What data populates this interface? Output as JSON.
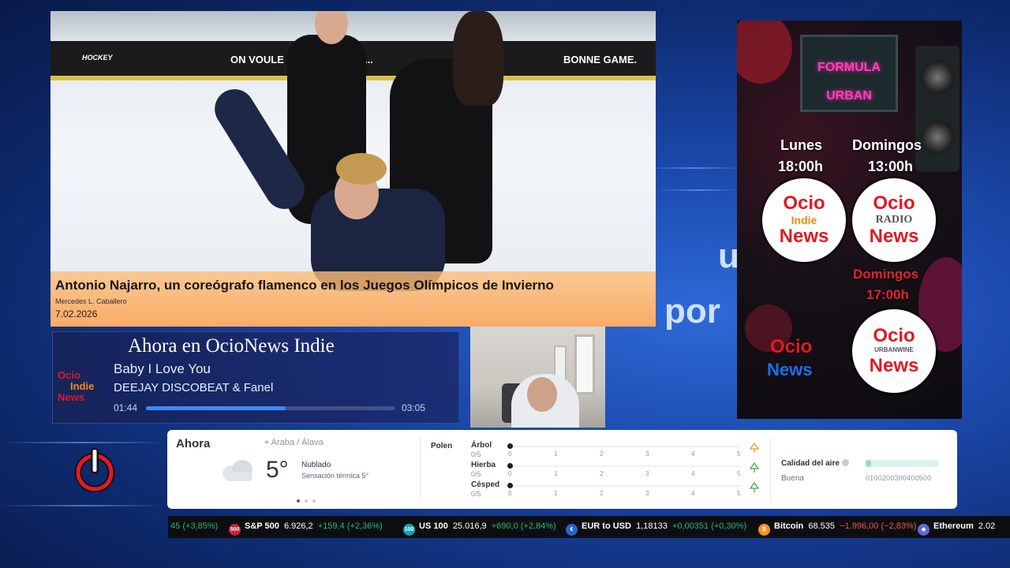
{
  "background": {
    "text_fragment_1": "u",
    "text_fragment_2": "por"
  },
  "news": {
    "title": "Antonio Najarro, un coreógrafo flamenco en los Juegos Olímpicos de Invierno",
    "author": "Mercedes L. Caballero",
    "date": "7.02.2026",
    "board_text_left": "ON VOULE",
    "board_text_mid": "RE...",
    "board_text_right": "BONNE GAME.",
    "board_brand": "HOCKEY"
  },
  "now_playing": {
    "header": "Ahora en OcioNews Indie",
    "song": "Baby I Love You",
    "artist": "DEEJAY DISCOBEAT & Fanel",
    "elapsed": "01:44",
    "duration": "03:05",
    "progress": 0.56,
    "logo": {
      "line1": "Ocio",
      "line2": "Indie",
      "line3": "News"
    }
  },
  "poster": {
    "tv_line1": "FORMULA",
    "tv_line2": "URBAN",
    "day_left": "Lunes",
    "hour_left": "18:00h",
    "day_right": "Domingos",
    "hour_right": "13:00h",
    "red_day": "Domingos",
    "red_hour": "17:00h",
    "logo_indie": {
      "top": "Ocio",
      "mid": "Indie",
      "bottom": "News"
    },
    "logo_radio": {
      "top": "Ocio",
      "mid": "RADIO",
      "bottom": "News"
    },
    "logo_plain": {
      "top": "Ocio",
      "bottom": "News"
    },
    "logo_urban": {
      "top": "Ocio",
      "mid": "URBANWINE",
      "bottom": "News"
    }
  },
  "weather": {
    "now_label": "Ahora",
    "location": "Araba / Álava",
    "temperature": "5°",
    "condition": "Nublado",
    "feels_like": "Sensación térmica 5°",
    "pages": 3,
    "active_page": 0,
    "pollen": {
      "title": "Polen",
      "rows": [
        {
          "name": "Árbol",
          "score": "0/5",
          "value": 0
        },
        {
          "name": "Hierba",
          "score": "0/5",
          "value": 0
        },
        {
          "name": "Césped",
          "score": "0/5",
          "value": 0
        }
      ],
      "ticks": [
        "0",
        "1",
        "2",
        "3",
        "4",
        "5"
      ]
    },
    "air": {
      "title": "Calidad del aire",
      "value": "Buena",
      "scale": "0100200300400500"
    }
  },
  "ticker": {
    "items": [
      {
        "badge": "",
        "name": "",
        "value": "",
        "change": "45 (+3,85%)",
        "dir": "up"
      },
      {
        "badge": "500",
        "badge_color": "#c8213a",
        "name": "S&P 500",
        "value": "6.926,2",
        "change": "+159,4 (+2,36%)",
        "dir": "up"
      },
      {
        "badge": "100",
        "badge_color": "#12a3b8",
        "name": "US 100",
        "value": "25.016,9",
        "change": "+690,0 (+2,84%)",
        "dir": "up"
      },
      {
        "badge": "€",
        "badge_color": "#2a62d0",
        "name": "EUR to USD",
        "value": "1,18133",
        "change": "+0,00351 (+0,30%)",
        "dir": "up"
      },
      {
        "badge": "₿",
        "badge_color": "#f29418",
        "name": "Bitcoin",
        "value": "68.535",
        "change": "−1.996,00 (−2,83%)",
        "dir": "down"
      },
      {
        "badge": "◆",
        "badge_color": "#5c6bd8",
        "name": "Ethereum",
        "value": "2.02",
        "change": "",
        "dir": "down"
      }
    ]
  }
}
